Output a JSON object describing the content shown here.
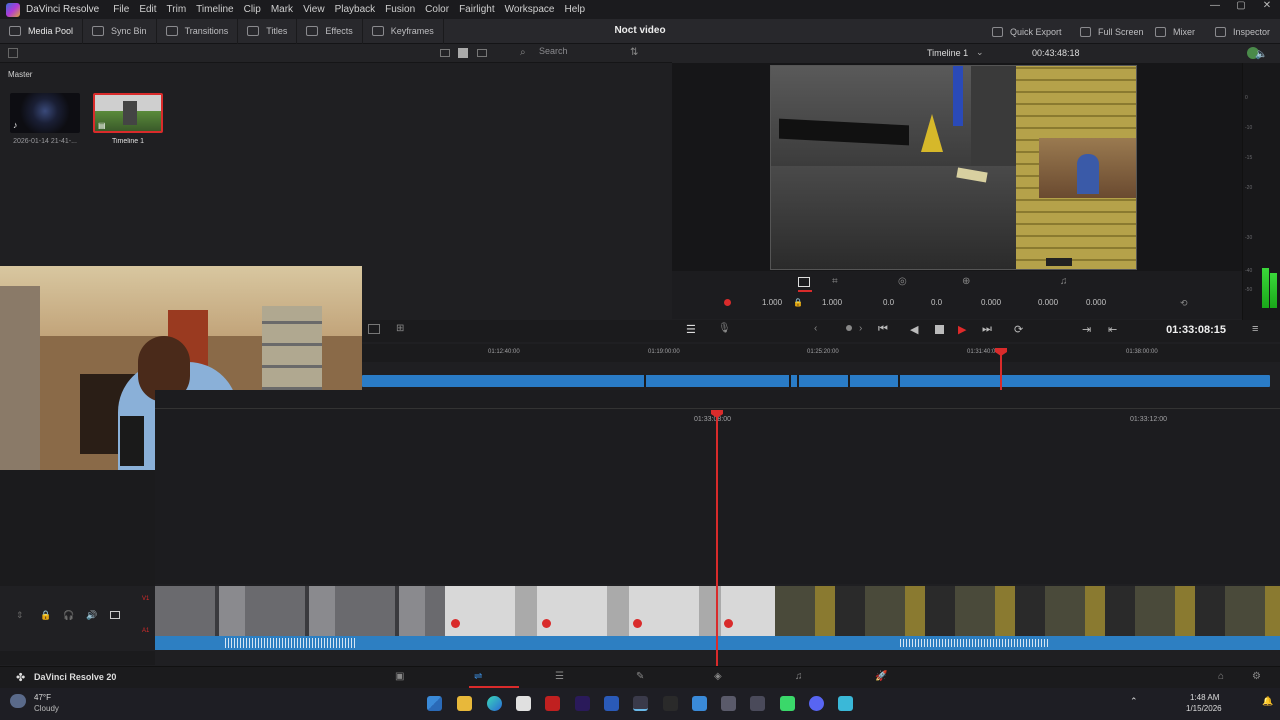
{
  "menubar": {
    "app_name": "DaVinci Resolve",
    "items": [
      "File",
      "Edit",
      "Trim",
      "Timeline",
      "Clip",
      "Mark",
      "View",
      "Playback",
      "Fusion",
      "Color",
      "Fairlight",
      "Workspace",
      "Help"
    ]
  },
  "toolbar": {
    "media_pool": "Media Pool",
    "sync_bin": "Sync Bin",
    "transitions": "Transitions",
    "titles": "Titles",
    "effects": "Effects",
    "keyframes": "Keyframes",
    "project_title": "Noct video",
    "quick_export": "Quick Export",
    "full_screen": "Full Screen",
    "mixer": "Mixer",
    "inspector": "Inspector"
  },
  "media_pool": {
    "search_placeholder": "Search",
    "bin_name": "Master",
    "clips": [
      {
        "label": "2026-01-14 21-41-..."
      },
      {
        "label": "Timeline 1"
      }
    ]
  },
  "viewer": {
    "timeline_name": "Timeline 1",
    "timecode": "00:43:48:18",
    "transform": {
      "zoom_x": "1.000",
      "zoom_y": "1.000",
      "pos_x": "0.0",
      "pos_y": "0.0",
      "rotation": "0.000",
      "pitch": "0.000",
      "yaw": "0.000"
    }
  },
  "meters": {
    "scale": [
      "0",
      "-5",
      "-10",
      "-15",
      "-20",
      "-30",
      "-40",
      "-50"
    ]
  },
  "transport": {
    "timecode": "01:33:08:15"
  },
  "upper_ruler": {
    "ticks": [
      "01:12:40:00",
      "01:19:00:00",
      "01:25:20:00",
      "01:31:40:00",
      "01:38:00:00"
    ]
  },
  "lower_ruler": {
    "ticks": [
      "01:33:08:00",
      "01:33:12:00"
    ]
  },
  "tracks": {
    "video": "V1",
    "audio": "A1"
  },
  "status": {
    "product": "DaVinci Resolve 20"
  },
  "weather": {
    "temp": "47°F",
    "condition": "Cloudy"
  },
  "clock": {
    "time": "1:48 AM",
    "date": "1/15/2026"
  },
  "colors": {
    "accent": "#d92b2b",
    "clip_blue": "#2a7cc7",
    "panel": "#1f1f22"
  }
}
